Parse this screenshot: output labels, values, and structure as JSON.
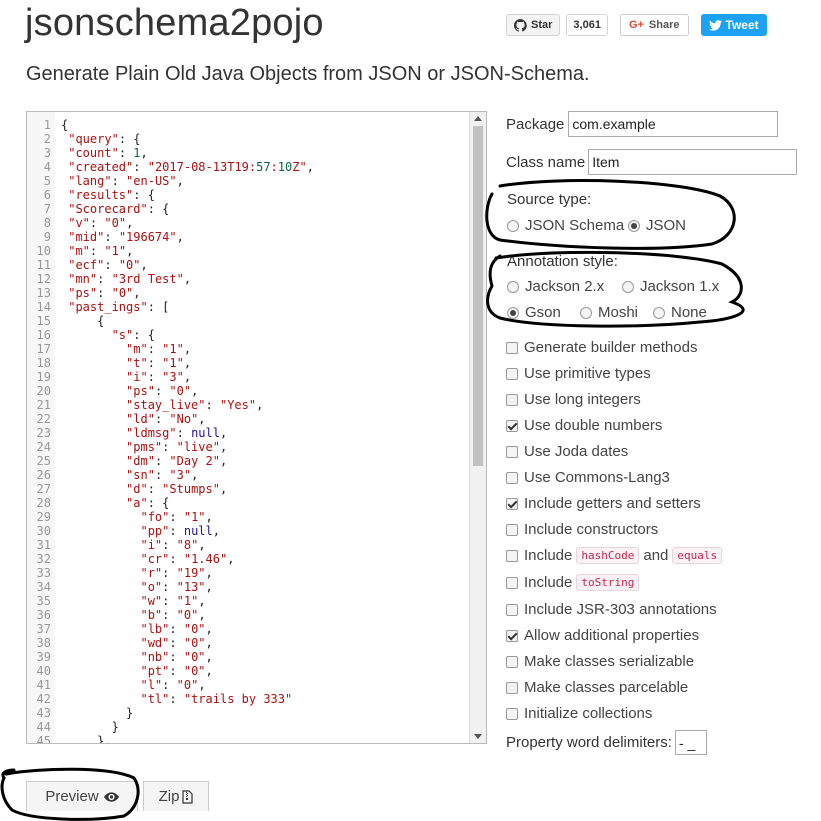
{
  "header": {
    "title": "jsonschema2pojo",
    "subtitle": "Generate Plain Old Java Objects from JSON or JSON-Schema."
  },
  "social": {
    "star_label": "Star",
    "star_count": "3,061",
    "share_label": "Share",
    "gplus_mark": "G+",
    "tweet_label": "Tweet"
  },
  "editor": {
    "lines": [
      "{",
      " \"query\": {",
      " \"count\": 1,",
      " \"created\": \"2017-08-13T19:57:10Z\",",
      " \"lang\": \"en-US\",",
      " \"results\": {",
      " \"Scorecard\": {",
      " \"v\": \"0\",",
      " \"mid\": \"196674\",",
      " \"m\": \"1\",",
      " \"ecf\": \"0\",",
      " \"mn\": \"3rd Test\",",
      " \"ps\": \"0\",",
      " \"past_ings\": [",
      "     {",
      "       \"s\": {",
      "         \"m\": \"1\",",
      "         \"t\": \"1\",",
      "         \"i\": \"3\",",
      "         \"ps\": \"0\",",
      "         \"stay_live\": \"Yes\",",
      "         \"ld\": \"No\",",
      "         \"ldmsg\": null,",
      "         \"pms\": \"live\",",
      "         \"dm\": \"Day 2\",",
      "         \"sn\": \"3\",",
      "         \"d\": \"Stumps\",",
      "         \"a\": {",
      "           \"fo\": \"1\",",
      "           \"pp\": null,",
      "           \"i\": \"8\",",
      "           \"cr\": \"1.46\",",
      "           \"r\": \"19\",",
      "           \"o\": \"13\",",
      "           \"w\": \"1\",",
      "           \"b\": \"0\",",
      "           \"lb\": \"0\",",
      "           \"wd\": \"0\",",
      "           \"nb\": \"0\",",
      "           \"pt\": \"0\",",
      "           \"l\": \"0\",",
      "           \"tl\": \"trails by 333\"",
      "         }",
      "       }",
      "     },"
    ]
  },
  "options": {
    "package_label": "Package",
    "package_value": "com.example",
    "classname_label": "Class name",
    "classname_value": "Item",
    "source_type_label": "Source type:",
    "source_types": [
      {
        "label": "JSON Schema",
        "selected": false
      },
      {
        "label": "JSON",
        "selected": true
      }
    ],
    "annotation_label": "Annotation style:",
    "annotations": [
      {
        "label": "Jackson 2.x",
        "selected": false
      },
      {
        "label": "Jackson 1.x",
        "selected": false
      },
      {
        "label": "Gson",
        "selected": true
      },
      {
        "label": "Moshi",
        "selected": false
      },
      {
        "label": "None",
        "selected": false
      }
    ],
    "checkboxes": [
      {
        "label": "Generate builder methods",
        "checked": false
      },
      {
        "label": "Use primitive types",
        "checked": false
      },
      {
        "label": "Use long integers",
        "checked": false
      },
      {
        "label": "Use double numbers",
        "checked": true
      },
      {
        "label": "Use Joda dates",
        "checked": false
      },
      {
        "label": "Use Commons-Lang3",
        "checked": false
      },
      {
        "label": "Include getters and setters",
        "checked": true
      },
      {
        "label": "Include constructors",
        "checked": false
      }
    ],
    "hash_row": {
      "pre": "Include",
      "code1": "hashCode",
      "mid": "and",
      "code2": "equals",
      "checked": false
    },
    "tostring_row": {
      "pre": "Include",
      "code": "toString",
      "checked": false
    },
    "checkboxes2": [
      {
        "label": "Include JSR-303 annotations",
        "checked": false
      },
      {
        "label": "Allow additional properties",
        "checked": true
      },
      {
        "label": "Make classes serializable",
        "checked": false
      },
      {
        "label": "Make classes parcelable",
        "checked": false
      },
      {
        "label": "Initialize collections",
        "checked": false
      }
    ],
    "delimiters_label": "Property word delimiters:",
    "delimiters_value": "- _"
  },
  "actions": {
    "preview_label": "Preview",
    "zip_label": "Zip"
  },
  "colors": {
    "tweet": "#1da1f2",
    "gplus": "#dd4b39",
    "code_tag": "#c7254e",
    "annotation_ink": "#000000"
  }
}
